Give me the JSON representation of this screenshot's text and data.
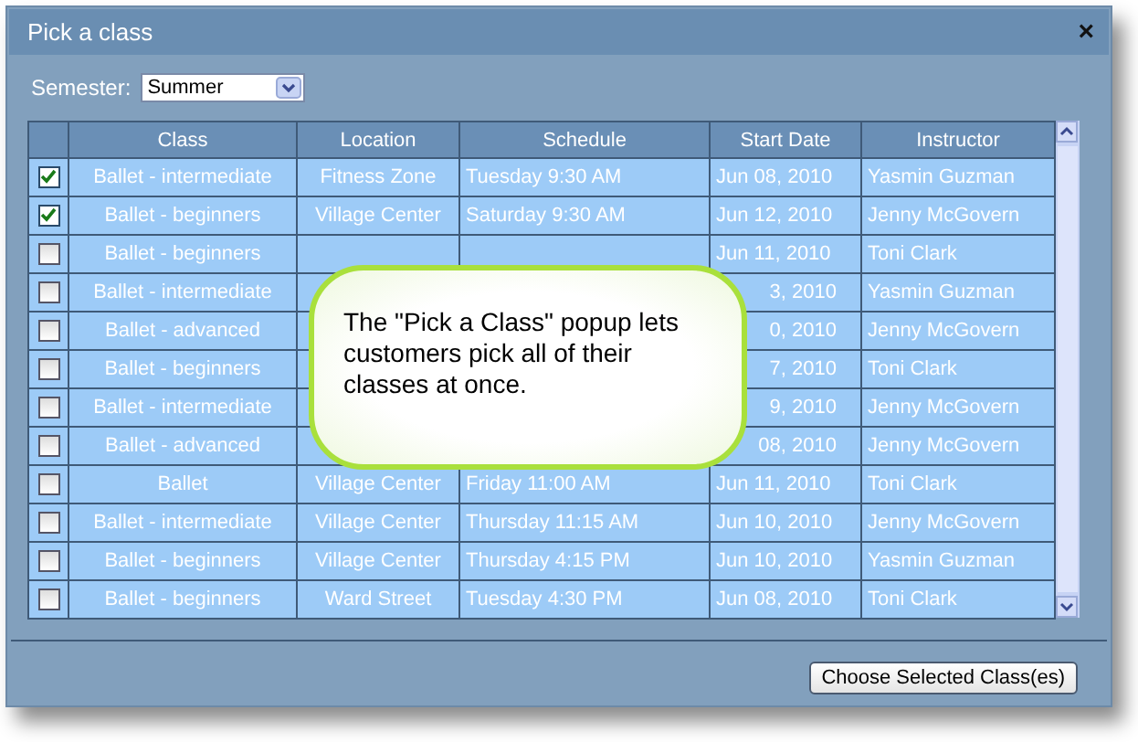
{
  "window": {
    "title": "Pick a class",
    "close": "×"
  },
  "semester": {
    "label": "Semester:",
    "value": "Summer"
  },
  "table": {
    "columns": [
      "Class",
      "Location",
      "Schedule",
      "Start Date",
      "Instructor"
    ],
    "rows": [
      {
        "kind": "full",
        "checked": true,
        "cells": [
          "Ballet - intermediate",
          "Fitness Zone",
          "Tuesday 9:30 AM",
          "Jun 08, 2010",
          "Yasmin Guzman"
        ]
      },
      {
        "kind": "full",
        "checked": true,
        "cells": [
          "Ballet - beginners",
          "Village Center",
          "Saturday 9:30 AM",
          "Jun 12, 2010",
          "Jenny McGovern"
        ]
      },
      {
        "kind": "under-callout",
        "checked": false,
        "cells": [
          "Ballet - beginners",
          "Jun 11, 2010",
          "Toni Clark"
        ]
      },
      {
        "kind": "under-callout-tail",
        "checked": false,
        "cells": [
          "Ballet - intermediate",
          "3, 2010",
          "Yasmin Guzman"
        ]
      },
      {
        "kind": "under-callout-tail",
        "checked": false,
        "cells": [
          "Ballet - advanced",
          "0, 2010",
          "Jenny McGovern"
        ]
      },
      {
        "kind": "under-callout-tail",
        "checked": false,
        "cells": [
          "Ballet - beginners",
          "7, 2010",
          "Toni Clark"
        ]
      },
      {
        "kind": "under-callout-tail",
        "checked": false,
        "cells": [
          "Ballet - intermediate",
          "9, 2010",
          "Jenny McGovern"
        ]
      },
      {
        "kind": "under-callout-tail",
        "checked": false,
        "cells": [
          "Ballet - advanced",
          "08, 2010",
          "Jenny McGovern"
        ]
      },
      {
        "kind": "full",
        "checked": false,
        "cells": [
          "Ballet",
          "Village Center",
          "Friday 11:00 AM",
          "Jun 11, 2010",
          "Toni Clark"
        ]
      },
      {
        "kind": "full",
        "checked": false,
        "cells": [
          "Ballet - intermediate",
          "Village Center",
          "Thursday 11:15 AM",
          "Jun 10, 2010",
          "Jenny McGovern"
        ]
      },
      {
        "kind": "full",
        "checked": false,
        "cells": [
          "Ballet - beginners",
          "Village Center",
          "Thursday 4:15 PM",
          "Jun 10, 2010",
          "Yasmin Guzman"
        ]
      },
      {
        "kind": "full",
        "checked": false,
        "cells": [
          "Ballet - beginners",
          "Ward Street",
          "Tuesday 4:30 PM",
          "Jun 08, 2010",
          "Toni Clark"
        ]
      }
    ]
  },
  "callout": {
    "text": "The \"Pick a Class\" popup lets customers pick all of their classes at once."
  },
  "buttons": [
    "Choose Selected Class(es)"
  ]
}
